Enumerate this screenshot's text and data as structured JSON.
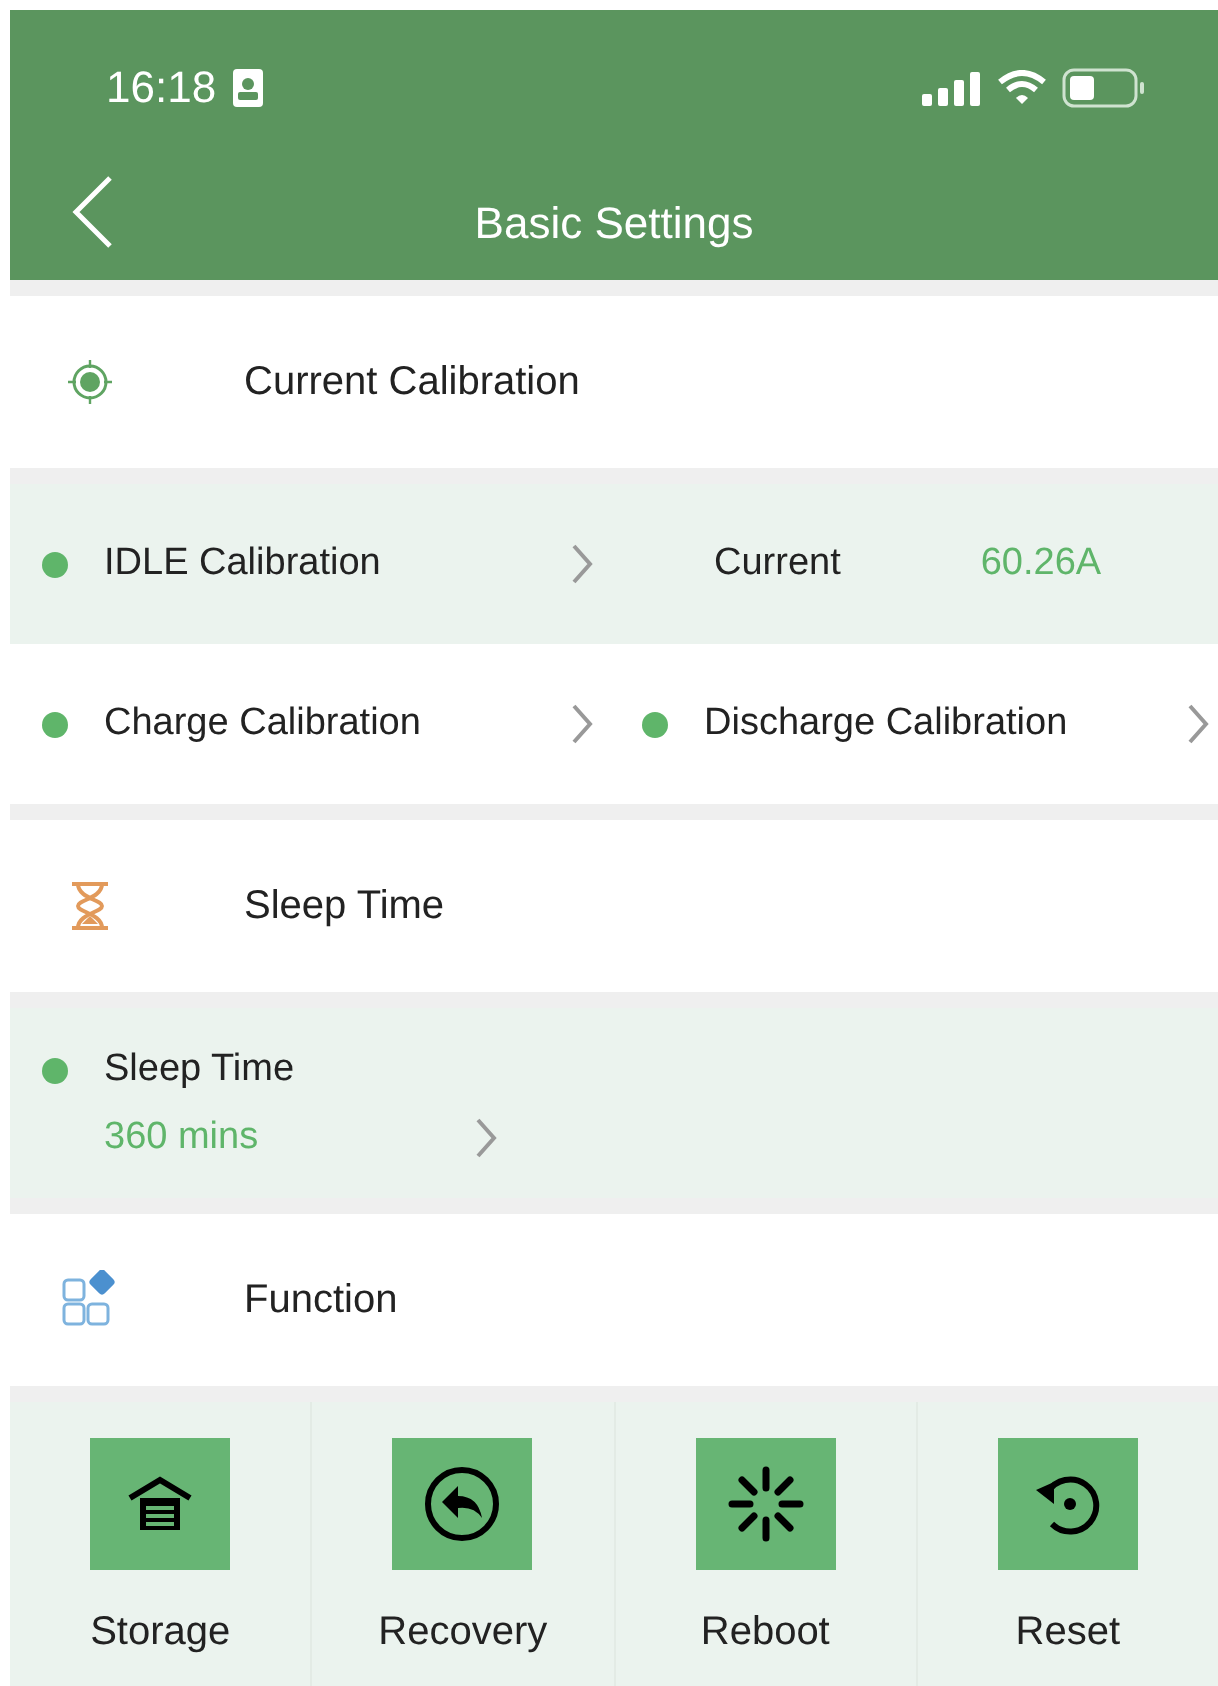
{
  "status_bar": {
    "time": "16:18"
  },
  "nav": {
    "title": "Basic Settings"
  },
  "calibration": {
    "title": "Current Calibration",
    "idle": "IDLE Calibration",
    "current_label": "Current",
    "current_value": "60.26A",
    "charge": "Charge Calibration",
    "discharge": "Discharge Calibration"
  },
  "sleep": {
    "title": "Sleep Time",
    "label": "Sleep Time",
    "value": "360 mins"
  },
  "function": {
    "title": "Function",
    "buttons": [
      {
        "kind": "storage",
        "label": "Storage"
      },
      {
        "kind": "recovery",
        "label": "Recovery"
      },
      {
        "kind": "reboot",
        "label": "Reboot"
      },
      {
        "kind": "reset",
        "label": "Reset"
      }
    ]
  }
}
